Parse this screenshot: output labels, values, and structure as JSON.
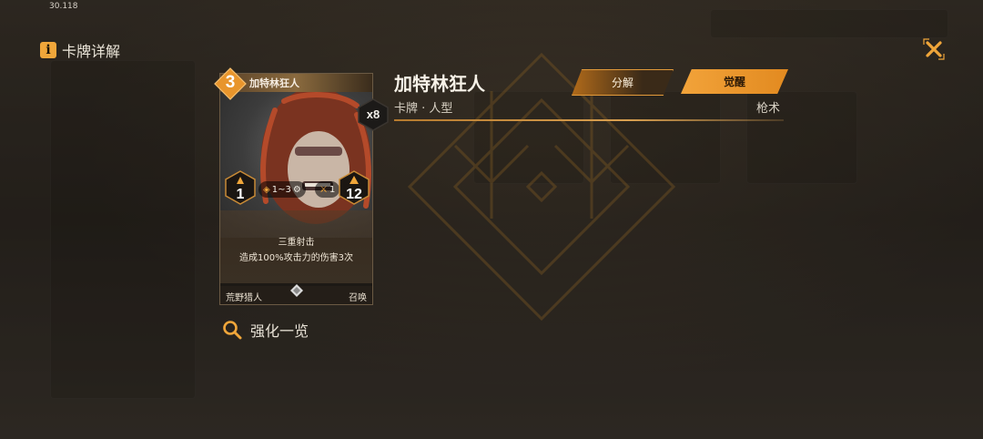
{
  "status": {
    "fps": "30.118"
  },
  "header": {
    "title": "卡牌详解"
  },
  "card": {
    "name": "加特林狂人",
    "cost": "3",
    "count": "x8",
    "stats": {
      "left": "1",
      "range": "1~3",
      "mid": "1",
      "right": "12"
    },
    "skill_name": "三重射击",
    "skill_desc": "造成100%攻击力的伤害3次",
    "faction": "荒野猎人",
    "type": "召唤"
  },
  "detail": {
    "name": "加特林狂人",
    "subtitle": "卡牌 · 人型",
    "tag": "枪术",
    "decompose_label": "分解",
    "awaken_label": "觉醒"
  },
  "enhance": {
    "label": "强化一览"
  },
  "colors": {
    "accent": "#f0a63a",
    "panel": "#2b2622"
  }
}
